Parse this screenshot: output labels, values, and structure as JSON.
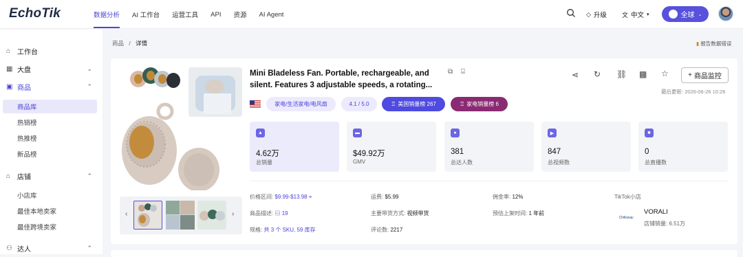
{
  "app": {
    "logo": "EchoTik"
  },
  "nav": {
    "items": [
      "数据分析",
      "AI 工作台",
      "运营工具",
      "API",
      "资源",
      "AI Agent"
    ],
    "active": 0
  },
  "header": {
    "upgrade": "升级",
    "language": "中文",
    "region": "全球"
  },
  "sidebar": {
    "workbench": "工作台",
    "dashboard": "大盘",
    "products": "商品",
    "product_subs": [
      "商品库",
      "热销榜",
      "热推榜",
      "新品榜"
    ],
    "stores": "店铺",
    "store_subs": [
      "小店库",
      "最佳本地卖家",
      "最佳跨境卖家"
    ],
    "creators": "达人"
  },
  "breadcrumb": {
    "parent": "商品",
    "sep": "/",
    "current": "详情"
  },
  "report_error": "报告数据错误",
  "product": {
    "title": "Mini Bladeless Fan. Portable, rechargeable, and silent. Features 3 adjustable speeds, a rotating...",
    "category": "家电/生活家电/电风扇",
    "rating": "4.1 / 5.0",
    "rank_us": "美国销量榜 267",
    "rank_appliance": "家电销量榜 6",
    "monitor_label": "商品监控",
    "last_update_label": "最后更新:",
    "last_update": "2026-06-26 10:26"
  },
  "stats": [
    {
      "value": "4.62万",
      "label": "总销量"
    },
    {
      "value": "$49.92万",
      "label": "GMV"
    },
    {
      "value": "381",
      "label": "总达人数"
    },
    {
      "value": "847",
      "label": "总视频数"
    },
    {
      "value": "0",
      "label": "总直播数"
    }
  ],
  "details": {
    "price_label": "价格区间:",
    "price": "$9.99-$13.98",
    "shipping_label": "运费:",
    "shipping": "$5.99",
    "commission_label": "佣金率:",
    "commission": "12%",
    "shop_type": "TikTok小店",
    "desc_label": "商品描述:",
    "desc": "19",
    "channel_label": "主要带货方式:",
    "channel": "视频带货",
    "listed_label": "预估上架时间:",
    "listed": "1 年前",
    "sku_label": "规格:",
    "sku": "共 3 个 SKU, 59 库存",
    "reviews_label": "评论数:",
    "reviews": "2217",
    "store_name": "VORALI",
    "store_sales_label": "店铺销量:",
    "store_sales": "6.51万",
    "store_logo_text": "Chillsway"
  },
  "colors": {
    "accent": "#4b45d8",
    "rank_us_bg": "#4f4ae0",
    "rank_appliance_bg": "#8a2a72",
    "tag_bg": "#eceafc"
  }
}
